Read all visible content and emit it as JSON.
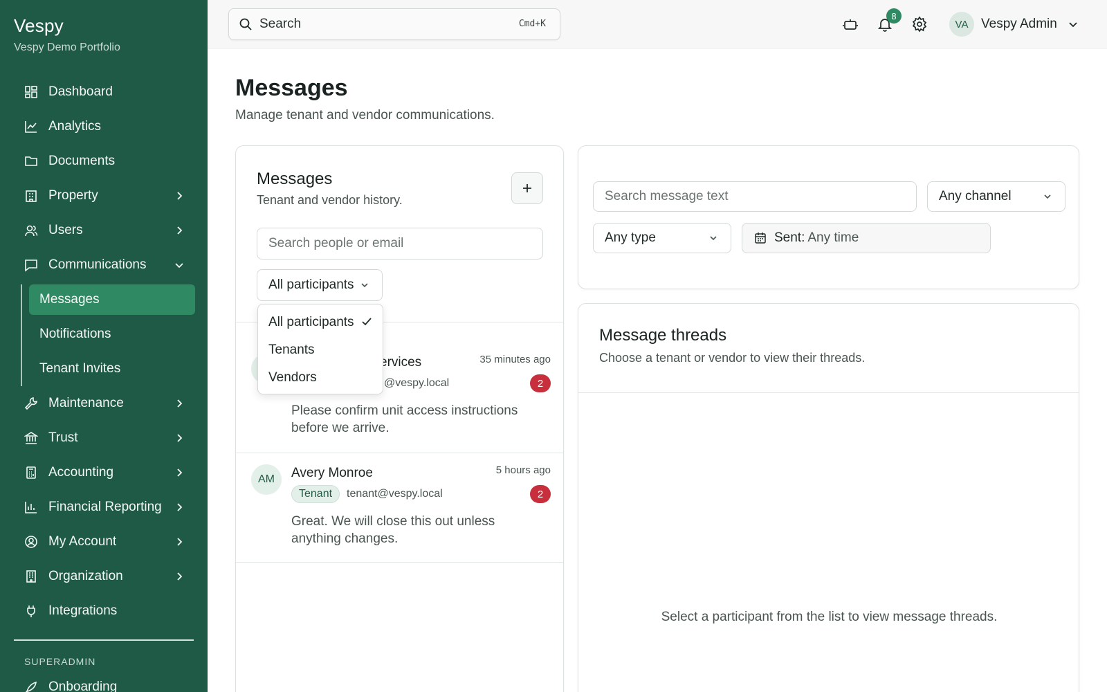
{
  "app": {
    "name": "Vespy",
    "portfolio": "Vespy Demo Portfolio"
  },
  "sidebar": {
    "items": [
      {
        "label": "Dashboard",
        "icon": "dashboard-icon"
      },
      {
        "label": "Analytics",
        "icon": "chart-line-icon"
      },
      {
        "label": "Documents",
        "icon": "folder-icon"
      },
      {
        "label": "Property",
        "icon": "building-icon",
        "expandable": true
      },
      {
        "label": "Users",
        "icon": "users-icon",
        "expandable": true
      },
      {
        "label": "Communications",
        "icon": "chat-icon",
        "expanded": true
      }
    ],
    "sub_items": [
      {
        "label": "Messages",
        "active": true
      },
      {
        "label": "Notifications"
      },
      {
        "label": "Tenant Invites"
      }
    ],
    "items_after": [
      {
        "label": "Maintenance",
        "icon": "wrench-icon"
      },
      {
        "label": "Trust",
        "icon": "bank-icon"
      },
      {
        "label": "Accounting",
        "icon": "calculator-icon"
      },
      {
        "label": "Financial Reporting",
        "icon": "bar-chart-icon"
      },
      {
        "label": "My Account",
        "icon": "user-circle-icon"
      },
      {
        "label": "Organization",
        "icon": "office-icon"
      },
      {
        "label": "Integrations",
        "icon": "plug-icon"
      }
    ],
    "section_label": "SUPERADMIN",
    "onboarding": "Onboarding"
  },
  "topbar": {
    "search_placeholder": "Search",
    "search_shortcut": "Cmd+K",
    "notifications_count": "8",
    "user_initials": "VA",
    "user_name": "Vespy Admin"
  },
  "page": {
    "title": "Messages",
    "subtitle": "Manage tenant and vendor communications."
  },
  "participants": {
    "title": "Messages",
    "subtitle": "Tenant and vendor history.",
    "search_placeholder": "Search people or email",
    "filter_value": "All participants",
    "filter_options": [
      "All participants",
      "Tenants",
      "Vendors"
    ],
    "threads": [
      {
        "initials": "",
        "name": "ervices",
        "tag": "",
        "email": "@vespy.local",
        "time": "35 minutes ago",
        "unread": "2",
        "preview": "Please confirm unit access instructions before we arrive."
      },
      {
        "initials": "AM",
        "name": "Avery Monroe",
        "tag": "Tenant",
        "email": "tenant@vespy.local",
        "time": "5 hours ago",
        "unread": "2",
        "preview": "Great. We will close this out unless anything changes."
      }
    ]
  },
  "filters": {
    "message_search_placeholder": "Search message text",
    "channel_value": "Any channel",
    "type_value": "Any type",
    "sent_label": "Sent:",
    "sent_value": "Any time"
  },
  "threads_panel": {
    "title": "Message threads",
    "subtitle": "Choose a tenant or vendor to view their threads.",
    "empty_text": "Select a participant from the list to view message threads."
  },
  "colors": {
    "sidebar_bg": "#1f5a47",
    "active_item": "#2f8a64",
    "unread_badge": "#c62f3b"
  }
}
